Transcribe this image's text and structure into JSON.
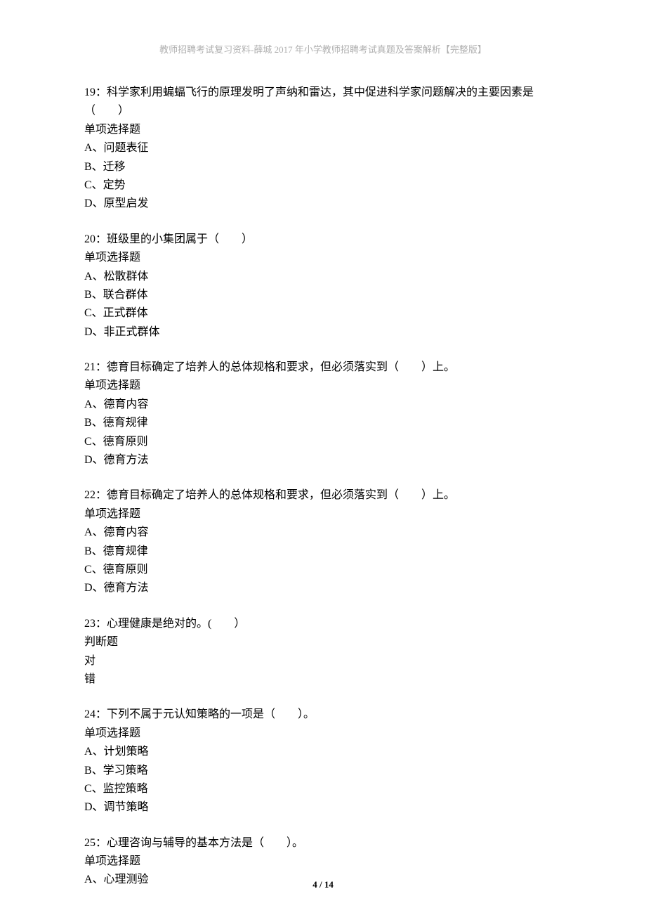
{
  "header": "教师招聘考试复习资料-薛城 2017 年小学教师招聘考试真题及答案解析【完整版】",
  "questions": [
    {
      "text": "19：科学家利用蝙蝠飞行的原理发明了声纳和雷达，其中促进科学家问题解决的主要因素是（　　）",
      "type": "单项选择题",
      "options": [
        "A、问题表征",
        "B、迁移",
        "C、定势",
        "D、原型启发"
      ]
    },
    {
      "text": "20：班级里的小集团属于（　　）",
      "type": "单项选择题",
      "options": [
        "A、松散群体",
        "B、联合群体",
        "C、正式群体",
        "D、非正式群体"
      ]
    },
    {
      "text": "21：德育目标确定了培养人的总体规格和要求，但必须落实到（　　）上。",
      "type": "单项选择题",
      "options": [
        "A、德育内容",
        "B、德育规律",
        "C、德育原则",
        "D、德育方法"
      ]
    },
    {
      "text": "22：德育目标确定了培养人的总体规格和要求，但必须落实到（　　）上。",
      "type": "单项选择题",
      "options": [
        "A、德育内容",
        "B、德育规律",
        "C、德育原则",
        "D、德育方法"
      ]
    },
    {
      "text": "23：心理健康是绝对的。(　　）",
      "type": "判断题",
      "options": [
        "对",
        "错"
      ]
    },
    {
      "text": "24：下列不属于元认知策略的一项是（　　）。",
      "type": "单项选择题",
      "options": [
        "A、计划策略",
        "B、学习策略",
        "C、监控策略",
        "D、调节策略"
      ]
    },
    {
      "text": "25：心理咨询与辅导的基本方法是（　　）。",
      "type": "单项选择题",
      "options": [
        "A、心理测验"
      ]
    }
  ],
  "footer": {
    "page": "4",
    "sep": " / ",
    "total": "14"
  }
}
